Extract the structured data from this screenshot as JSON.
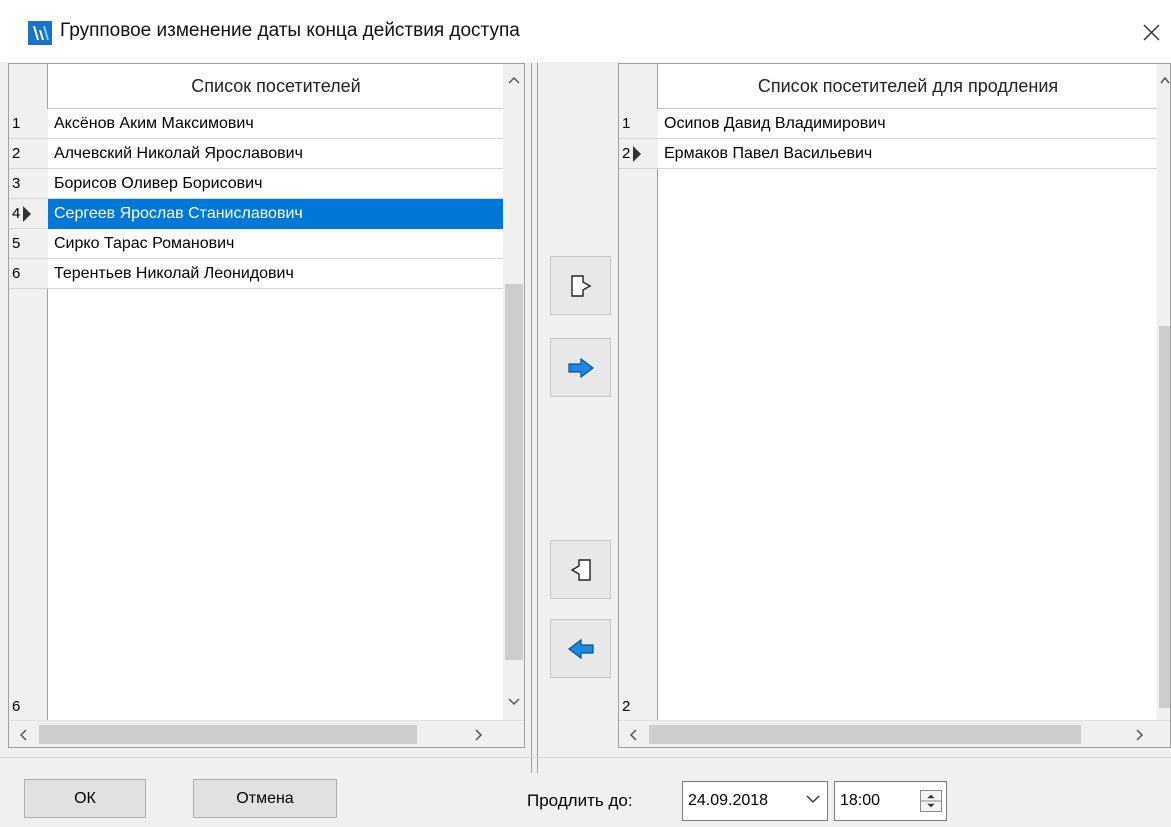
{
  "window": {
    "title": "Групповое изменение даты конца действия доступа",
    "app_icon": "access-app-icon",
    "close_icon": "close-icon"
  },
  "left_grid": {
    "header": "Список посетителей",
    "rows": [
      {
        "num": "1",
        "name": "Аксёнов Аким Максимович"
      },
      {
        "num": "2",
        "name": "Алчевский Николай Ярославович"
      },
      {
        "num": "3",
        "name": "Борисов Оливер Борисович"
      },
      {
        "num": "4",
        "name": "Сергеев Ярослав Станиславович"
      },
      {
        "num": "5",
        "name": "Сирко Тарас Романович"
      },
      {
        "num": "6",
        "name": "Терентьев Николай Леонидович"
      }
    ],
    "selected_row": 4,
    "footer_count": "6"
  },
  "right_grid": {
    "header": "Список посетителей для продления",
    "rows": [
      {
        "num": "1",
        "name": "Осипов Давид Владимирович"
      },
      {
        "num": "2",
        "name": "Ермаков Павел Васильевич"
      }
    ],
    "current_row": 2,
    "footer_count": "2"
  },
  "transfer_buttons": [
    {
      "icon": "move-all-right-icon"
    },
    {
      "icon": "move-right-arrow-icon",
      "color": "#1e88e5"
    },
    {
      "icon": "move-all-left-icon"
    },
    {
      "icon": "move-left-arrow-icon",
      "color": "#1e88e5"
    }
  ],
  "footer": {
    "ok_label": "ОК",
    "cancel_label": "Отмена",
    "extend_label": "Продлить до:",
    "date_value": "24.09.2018",
    "time_value": "18:00"
  },
  "colors": {
    "selection": "#0078d7",
    "arrow_blue": "#1e88e5",
    "app_icon": "#1a73c8"
  }
}
